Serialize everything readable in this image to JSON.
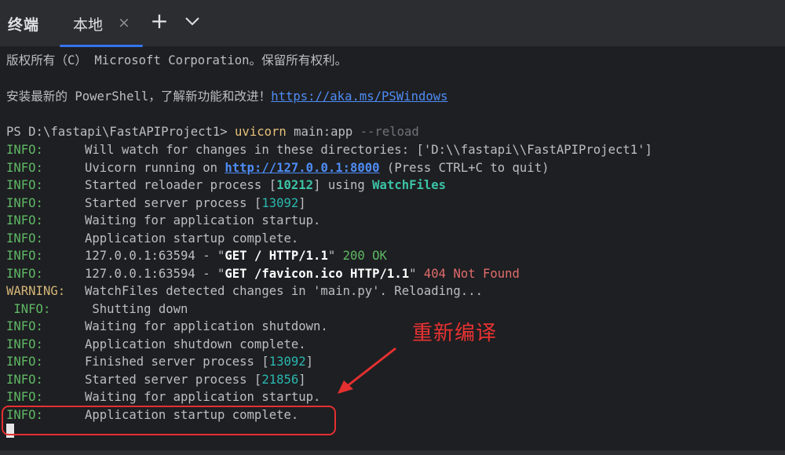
{
  "tabbar": {
    "title": "终端",
    "tab_label": "本地",
    "close_glyph": "×",
    "add_glyph": "+",
    "more_icon": "chevron-down-icon"
  },
  "terminal": {
    "copyright": "版权所有（C） Microsoft Corporation。保留所有权利。",
    "install_hint": "安装最新的 PowerShell，了解新功能和改进！",
    "install_link": "https://aka.ms/PSWindows",
    "prompt": "PS D:\\fastapi\\FastAPIProject1> ",
    "command": "uvicorn",
    "command_args": " main:app ",
    "command_flag": "--reload",
    "logs": [
      {
        "level": "INFO:",
        "parts": [
          {
            "t": "Will watch for changes in these directories: ['D:\\\\fastapi\\\\FastAPIProject1']",
            "c": ""
          }
        ]
      },
      {
        "level": "INFO:",
        "parts": [
          {
            "t": "Uvicorn running on ",
            "c": ""
          },
          {
            "t": "http://127.0.0.1:8000",
            "c": "linkb"
          },
          {
            "t": " (Press CTRL+C to quit)",
            "c": ""
          }
        ]
      },
      {
        "level": "INFO:",
        "parts": [
          {
            "t": "Started reloader process [",
            "c": ""
          },
          {
            "t": "10212",
            "c": "cyb"
          },
          {
            "t": "] using ",
            "c": ""
          },
          {
            "t": "WatchFiles",
            "c": "cyb"
          }
        ]
      },
      {
        "level": "INFO:",
        "parts": [
          {
            "t": "Started server process [",
            "c": ""
          },
          {
            "t": "13092",
            "c": "cy"
          },
          {
            "t": "]",
            "c": ""
          }
        ]
      },
      {
        "level": "INFO:",
        "parts": [
          {
            "t": "Waiting for application startup.",
            "c": ""
          }
        ]
      },
      {
        "level": "INFO:",
        "parts": [
          {
            "t": "Application startup complete.",
            "c": ""
          }
        ]
      },
      {
        "level": "INFO:",
        "parts": [
          {
            "t": "127.0.0.1:63594 - \"",
            "c": ""
          },
          {
            "t": "GET / HTTP/1.1",
            "c": "w"
          },
          {
            "t": "\" ",
            "c": ""
          },
          {
            "t": "200 OK",
            "c": "g"
          }
        ]
      },
      {
        "level": "INFO:",
        "parts": [
          {
            "t": "127.0.0.1:63594 - \"",
            "c": ""
          },
          {
            "t": "GET /favicon.ico HTTP/1.1",
            "c": "w"
          },
          {
            "t": "\" ",
            "c": ""
          },
          {
            "t": "404 Not Found",
            "c": "r"
          }
        ]
      },
      {
        "level": "WARNING:",
        "parts": [
          {
            "t": "WatchFiles detected changes in 'main.py'. Reloading...",
            "c": ""
          }
        ]
      },
      {
        "level": " INFO:",
        "parts": [
          {
            "t": " Shutting down",
            "c": ""
          }
        ]
      },
      {
        "level": "INFO:",
        "parts": [
          {
            "t": "Waiting for application shutdown.",
            "c": ""
          }
        ]
      },
      {
        "level": "INFO:",
        "parts": [
          {
            "t": "Application shutdown complete.",
            "c": ""
          }
        ]
      },
      {
        "level": "INFO:",
        "parts": [
          {
            "t": "Finished server process [",
            "c": ""
          },
          {
            "t": "13092",
            "c": "cy"
          },
          {
            "t": "]",
            "c": ""
          }
        ]
      },
      {
        "level": "INFO:",
        "parts": [
          {
            "t": "Started server process [",
            "c": ""
          },
          {
            "t": "21856",
            "c": "cy"
          },
          {
            "t": "]",
            "c": ""
          }
        ]
      },
      {
        "level": "INFO:",
        "parts": [
          {
            "t": "Waiting for application startup.",
            "c": ""
          }
        ]
      },
      {
        "level": "INFO:",
        "parts": [
          {
            "t": "Application startup complete.",
            "c": ""
          }
        ]
      }
    ]
  },
  "annotation": {
    "text": "重新编译",
    "color": "#e83232"
  },
  "colors": {
    "info": "#5fb865",
    "warning": "#d5b778",
    "number": "#29b8b0",
    "link": "#4e8cf5",
    "error": "#e06c6c",
    "accent": "#3574f0"
  }
}
